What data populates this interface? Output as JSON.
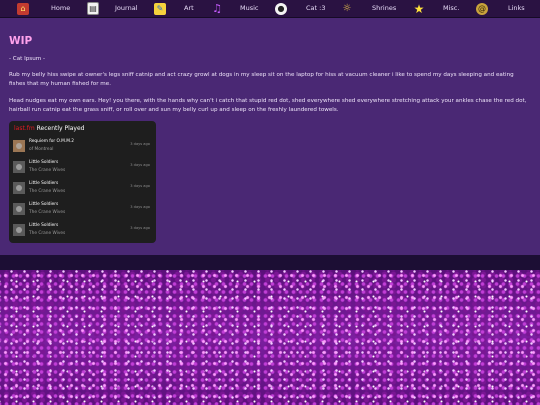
{
  "nav": {
    "items": [
      {
        "label": "Home",
        "icon": "house-icon"
      },
      {
        "label": "Journal",
        "icon": "book-icon"
      },
      {
        "label": "Art",
        "icon": "paint-icon"
      },
      {
        "label": "Music",
        "icon": "music-note-icon"
      },
      {
        "label": "Cat :3",
        "icon": "cat-icon"
      },
      {
        "label": "Shrines",
        "icon": "shrine-icon"
      },
      {
        "label": "Misc.",
        "icon": "star-icon"
      },
      {
        "label": "Links",
        "icon": "at-sign-icon"
      }
    ]
  },
  "main": {
    "title": "WIP",
    "subtitle": "- Cat Ipsum -",
    "paragraphs": [
      "Rub my belly hiss swipe at owner's legs sniff catnip and act crazy growl at dogs in my sleep sit on the laptop for hiss at vacuum cleaner i like to spend my days sleeping and eating fishes that my human fished for me.",
      "Head nudges eat my own ears. Hey! you there, with the hands why can't i catch that stupid red dot, shed everywhere shed everywhere stretching attack your ankles chase the red dot, hairball run catnip eat the grass sniff, or roll over and sun my belly curl up and sleep on the freshly laundered towels."
    ]
  },
  "widget": {
    "brand": "last.fm",
    "title": "Recently Played",
    "tracks": [
      {
        "name": "Requiem for O.M.M.2",
        "artist": "of Montreal",
        "time": "3 days ago"
      },
      {
        "name": "Little Soldiers",
        "artist": "The Crane Wives",
        "time": "3 days ago"
      },
      {
        "name": "Little Soldiers",
        "artist": "The Crane Wives",
        "time": "3 days ago"
      },
      {
        "name": "Little Soldiers",
        "artist": "The Crane Wives",
        "time": "3 days ago"
      },
      {
        "name": "Little Soldiers",
        "artist": "The Crane Wives",
        "time": "3 days ago"
      }
    ]
  },
  "colors": {
    "nav_bg": "#2a1242",
    "main_bg": "#4a2874",
    "title": "#ffa2ec",
    "text": "#f0e6fb",
    "lastfm_red": "#e31b23"
  }
}
